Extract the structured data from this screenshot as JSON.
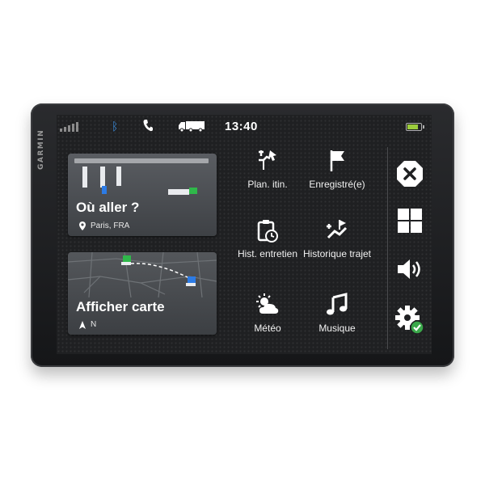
{
  "brand": {
    "name": "GARMIN"
  },
  "status_bar": {
    "time": "13:40",
    "icons": [
      "signal-icon",
      "bluetooth-icon",
      "phone-icon",
      "truck-icon",
      "battery-icon"
    ]
  },
  "cards": {
    "where_to": {
      "title": "Où aller ?",
      "location": "Paris, FRA"
    },
    "view_map": {
      "title": "Afficher carte",
      "heading": "N"
    }
  },
  "apps": [
    {
      "label": "Plan. itin.",
      "icon": "trip-planner-icon"
    },
    {
      "label": "Enregistré(e)",
      "icon": "saved-flag-icon"
    },
    {
      "label": "Hist. entretien",
      "icon": "service-history-icon"
    },
    {
      "label": "Historique trajet",
      "icon": "trip-history-icon"
    },
    {
      "label": "Météo",
      "icon": "weather-icon"
    },
    {
      "label": "Musique",
      "icon": "music-icon"
    }
  ],
  "sidebar": {
    "buttons": [
      "close-icon",
      "apps-grid-icon",
      "volume-icon",
      "settings-icon"
    ]
  },
  "colors": {
    "bluetooth": "#3d8fe0",
    "battery_fill": "#9ccc3c",
    "settings_check": "#3aa84a",
    "pin_blue": "#2c7be5",
    "pin_green": "#2fb84a"
  }
}
